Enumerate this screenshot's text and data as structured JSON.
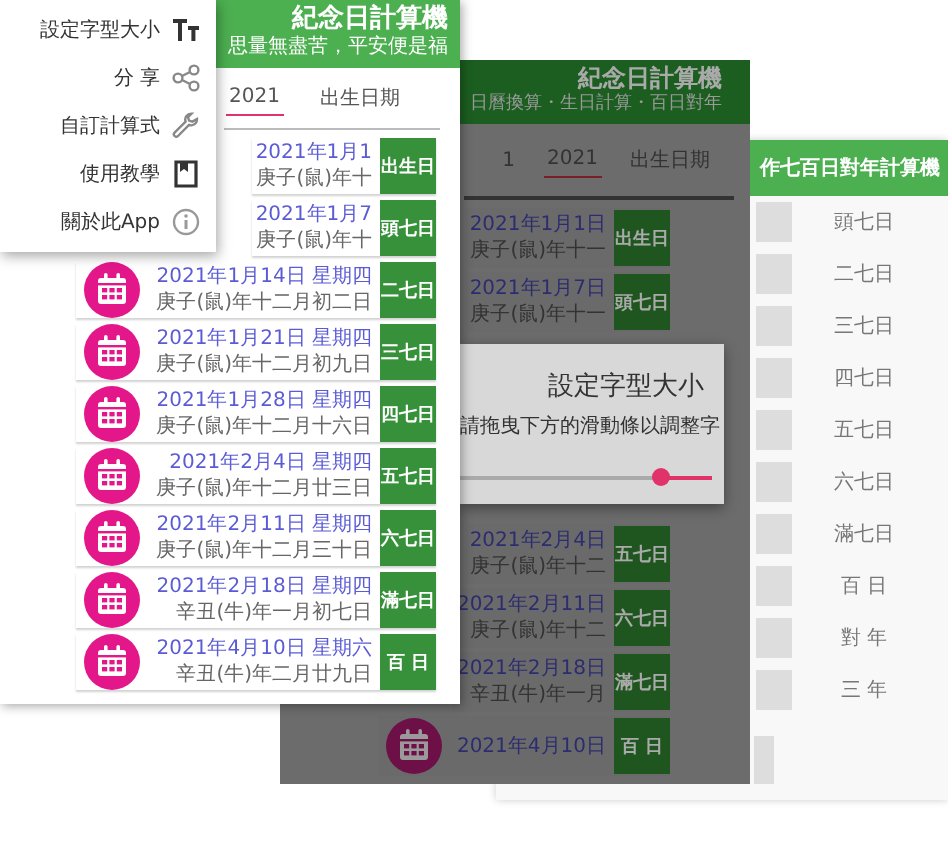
{
  "back_screen": {
    "title": "作七百日對年計算機",
    "rows": [
      {
        "label": "頭七日"
      },
      {
        "label": "二七日"
      },
      {
        "label": "三七日"
      },
      {
        "label": "四七日"
      },
      {
        "label": "五七日"
      },
      {
        "label": "六七日"
      },
      {
        "label": "滿七日"
      },
      {
        "label": "百 日"
      },
      {
        "label": "對 年"
      },
      {
        "label": "三 年"
      }
    ]
  },
  "middle_screen": {
    "title": "紀念日計算機",
    "subtitle": "日曆換算・生日計算・百日對年",
    "tabs": [
      {
        "label": "1",
        "selected": false
      },
      {
        "label": "2021",
        "selected": true
      },
      {
        "label": "出生日期",
        "selected": false
      }
    ],
    "rows_above": [
      {
        "label": "出生日",
        "date": "2021年1月1日",
        "lunar": "庚子(鼠)年十一",
        "calendar_icon": false
      },
      {
        "label": "頭七日",
        "date": "2021年1月7日",
        "lunar": "庚子(鼠)年十一",
        "calendar_icon": false
      }
    ],
    "rows_below": [
      {
        "label": "五七日",
        "date": "2021年2月4日",
        "lunar": "庚子(鼠)年十二",
        "calendar_icon": false
      },
      {
        "label": "六七日",
        "date": "2021年2月11日",
        "lunar": "庚子(鼠)年十二",
        "calendar_icon": false
      },
      {
        "label": "滿七日",
        "date": "2021年2月18日",
        "lunar": "辛丑(牛)年一月",
        "calendar_icon": false
      },
      {
        "label": "百 日",
        "date": "2021年4月10日",
        "calendar_icon": true
      }
    ],
    "dialog": {
      "title": "設定字型大小",
      "message": "請拖曳下方的滑動條以調整字",
      "slider": {
        "level": 0.2
      }
    }
  },
  "front_screen": {
    "title": "紀念日計算機",
    "subtitle": "思量無盡苦，平安便是福",
    "tabs": [
      {
        "label": "2021",
        "selected": true
      },
      {
        "label": "出生日期",
        "selected": false
      }
    ],
    "rows": [
      {
        "label": "出生日",
        "date": "2021年1月1",
        "lunar": "庚子(鼠)年十",
        "calendar_icon": false
      },
      {
        "label": "頭七日",
        "date": "2021年1月7",
        "lunar": "庚子(鼠)年十",
        "calendar_icon": false
      },
      {
        "label": "二七日",
        "date": "2021年1月14日 星期四",
        "lunar": "庚子(鼠)年十二月初二日",
        "calendar_icon": true
      },
      {
        "label": "三七日",
        "date": "2021年1月21日 星期四",
        "lunar": "庚子(鼠)年十二月初九日",
        "calendar_icon": true
      },
      {
        "label": "四七日",
        "date": "2021年1月28日 星期四",
        "lunar": "庚子(鼠)年十二月十六日",
        "calendar_icon": true
      },
      {
        "label": "五七日",
        "date": "2021年2月4日 星期四",
        "lunar": "庚子(鼠)年十二月廿三日",
        "calendar_icon": true
      },
      {
        "label": "六七日",
        "date": "2021年2月11日 星期四",
        "lunar": "庚子(鼠)年十二月三十日",
        "calendar_icon": true
      },
      {
        "label": "滿七日",
        "date": "2021年2月18日 星期四",
        "lunar": "辛丑(牛)年一月初七日",
        "calendar_icon": true
      },
      {
        "label": "百 日",
        "date": "2021年4月10日 星期六",
        "lunar": "辛丑(牛)年二月廿九日",
        "calendar_icon": true
      }
    ],
    "menu": [
      {
        "label": "設定字型大小"
      },
      {
        "label": "分 享"
      },
      {
        "label": "自訂計算式"
      },
      {
        "label": "使用教學"
      },
      {
        "label": "關於此App"
      }
    ]
  }
}
